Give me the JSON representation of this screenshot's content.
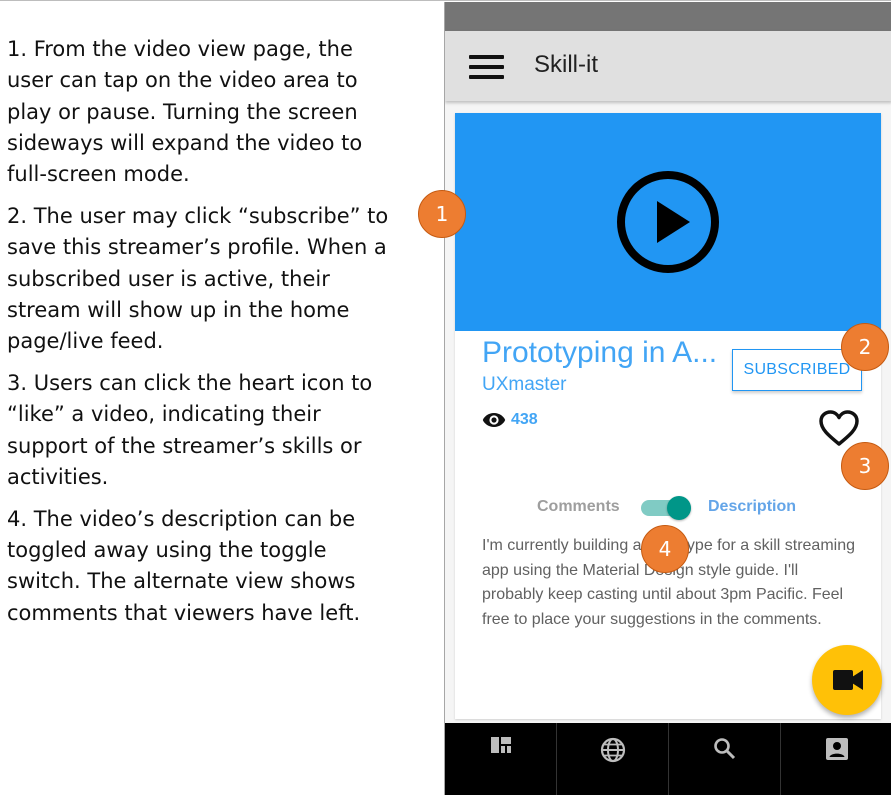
{
  "instructions": [
    "1. From the video view page, the user can tap on the video area to play or pause. Turning the screen sideways will expand the video to full-screen mode.",
    "2. The user may click “subscribe” to save this streamer’s profile. When a subscribed user is active, their stream will show up in the home page/live feed.",
    "3. Users can click the heart icon to “like” a video, indicating their support of the streamer’s skills or activities.",
    "4. The video’s description can be toggled away using the toggle switch. The alternate view shows comments that viewers have left."
  ],
  "app": {
    "title": "Skill-it"
  },
  "video": {
    "title": "Prototyping in A...",
    "author": "UXmaster",
    "views": "438",
    "subscribe_label": "SUBSCRIBED"
  },
  "toggle": {
    "left_label": "Comments",
    "right_label": "Description",
    "state": "Description"
  },
  "description": "I'm currently building a prototype for a skill streaming app using the Material Design style guide. I'll probably keep casting until about 3pm Pacific. Feel free to place your suggestions in the comments.",
  "bottom_nav": [
    {
      "icon": "dashboard-icon"
    },
    {
      "icon": "globe-icon"
    },
    {
      "icon": "search-icon"
    },
    {
      "icon": "account-box-icon"
    }
  ],
  "fab": {
    "icon": "videocam-icon"
  },
  "callouts": [
    "1",
    "2",
    "3",
    "4"
  ],
  "colors": {
    "primary": "#2196f3",
    "accent": "#ffc107",
    "callout": "#ed7d31",
    "toggle": "#009688",
    "nav": "#000000",
    "appbar": "#e0e0e0"
  }
}
